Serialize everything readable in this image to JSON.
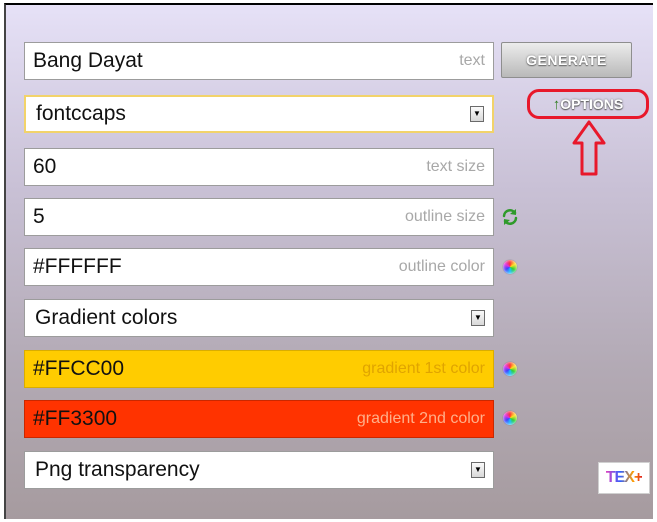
{
  "text_field": {
    "value": "Bang Dayat",
    "hint": "text"
  },
  "generate_button": {
    "label": "GENERATE"
  },
  "font_select": {
    "selected": "fontccaps"
  },
  "options_button": {
    "label": "OPTIONS"
  },
  "text_size": {
    "value": "60",
    "hint": "text size"
  },
  "outline_size": {
    "value": "5",
    "hint": "outline size"
  },
  "outline_color": {
    "value": "#FFFFFF",
    "hint": "outline color"
  },
  "fill_select": {
    "selected": "Gradient colors"
  },
  "gradient1": {
    "value": "#FFCC00",
    "hint": "gradient 1st color",
    "color": "#FFCC00"
  },
  "gradient2": {
    "value": "#FF3300",
    "hint": "gradient 2nd color",
    "color": "#FF3300"
  },
  "format_select": {
    "selected": "Png transparency"
  },
  "logo": {
    "text": "TEX+"
  },
  "colors": {
    "annotation_red": "#e8182b",
    "refresh_green": "#2e9a2a"
  }
}
